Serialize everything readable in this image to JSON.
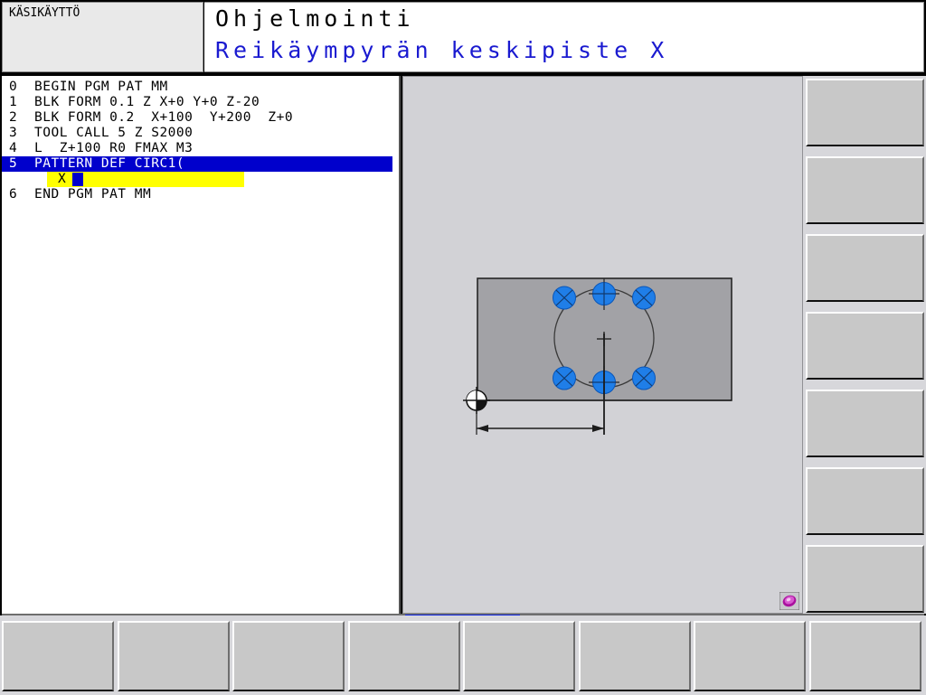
{
  "header": {
    "mode_label": "KÄSIKÄYTTÖ",
    "title_main": "Ohjelmointi",
    "title_sub": "Reikäympyrän keskipiste X"
  },
  "program": {
    "lines": [
      {
        "num": "0",
        "text": "BEGIN PGM PAT MM",
        "selected": false
      },
      {
        "num": "1",
        "text": "BLK FORM 0.1 Z X+0 Y+0 Z-20",
        "selected": false
      },
      {
        "num": "2",
        "text": "BLK FORM 0.2  X+100  Y+200  Z+0",
        "selected": false
      },
      {
        "num": "3",
        "text": "TOOL CALL 5 Z S2000",
        "selected": false
      },
      {
        "num": "4",
        "text": "L  Z+100 R0 FMAX M3",
        "selected": false
      },
      {
        "num": "5",
        "text": "PATTERN DEF CIRC1(",
        "selected": true
      },
      {
        "num": "6",
        "text": "END PGM PAT MM",
        "selected": false
      }
    ],
    "input_row": {
      "key": "X",
      "value": ""
    }
  },
  "graphics": {
    "description": "Bolt hole circle pattern help graphic",
    "hole_count": 6,
    "datum_symbol": "datum-origin",
    "dimension": "X center distance",
    "status_icon": "heidenhain-status-icon",
    "colors": {
      "workpiece": "#a2a2a6",
      "hole": "#1f7ee8",
      "background": "#d2d2d6",
      "line": "#303030"
    }
  },
  "softkeys": {
    "right": [
      {
        "label": ""
      },
      {
        "label": ""
      },
      {
        "label": ""
      },
      {
        "label": ""
      },
      {
        "label": ""
      },
      {
        "label": ""
      },
      {
        "label": ""
      }
    ],
    "bottom": [
      {
        "label": ""
      },
      {
        "label": ""
      },
      {
        "label": ""
      },
      {
        "label": ""
      },
      {
        "label": ""
      },
      {
        "label": ""
      },
      {
        "label": ""
      },
      {
        "label": ""
      }
    ]
  },
  "scroll_indicator": {
    "color": "#0b22e0"
  }
}
